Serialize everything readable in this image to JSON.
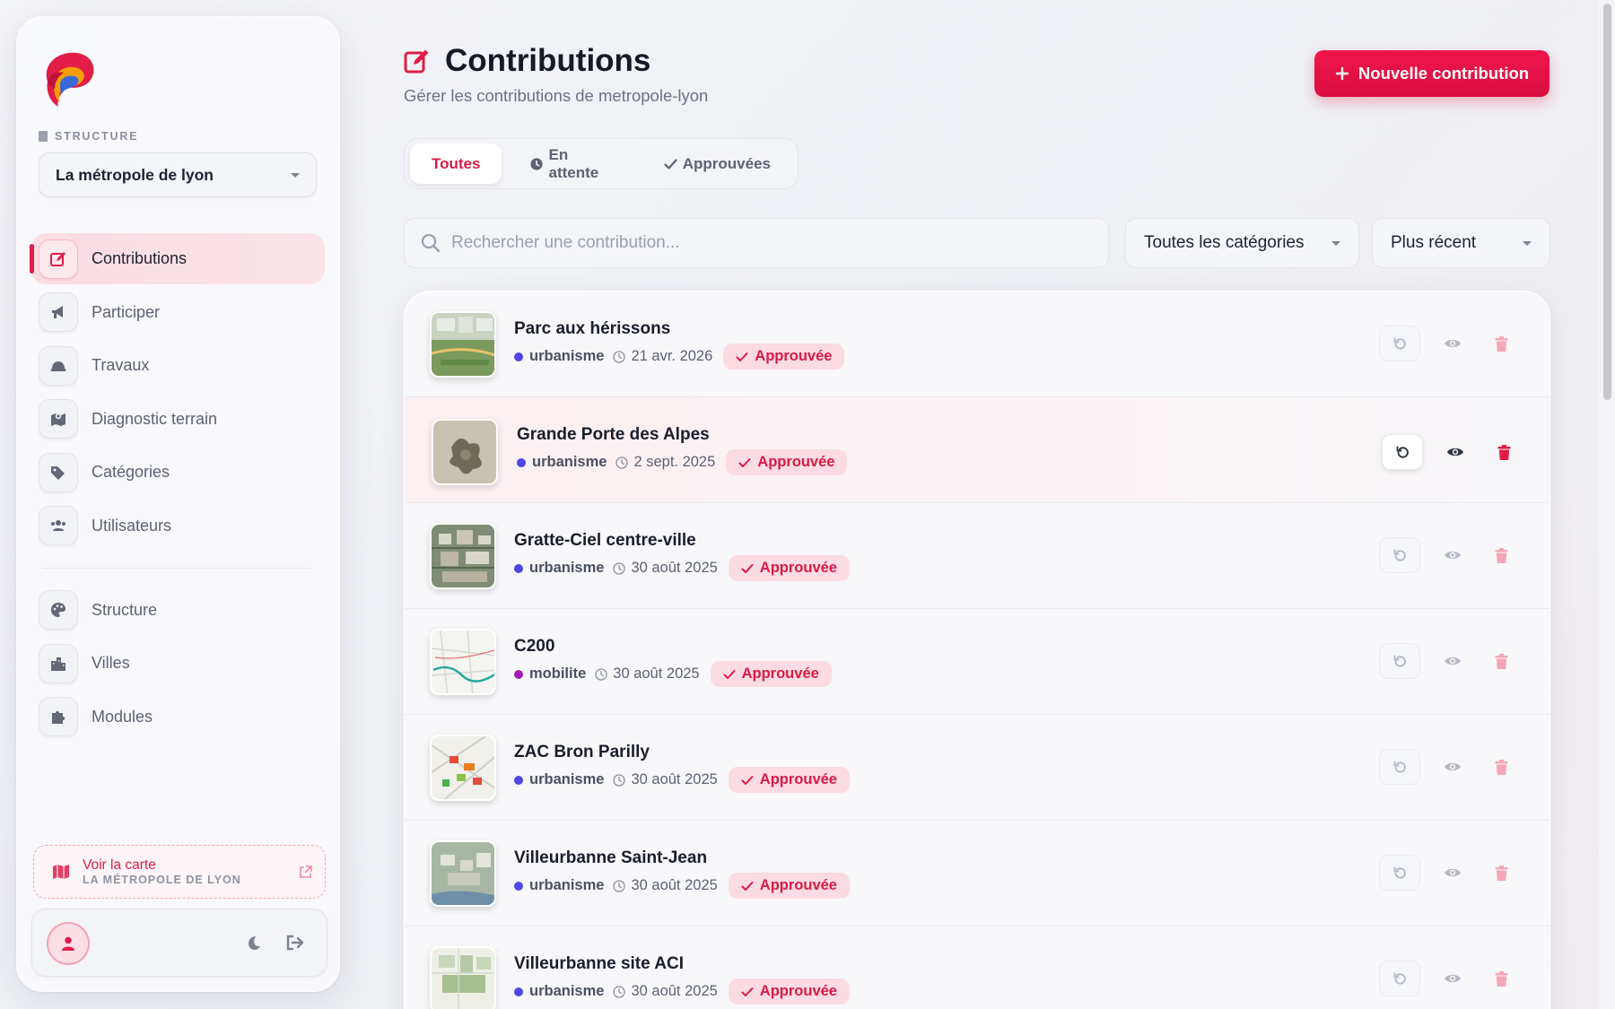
{
  "colors": {
    "accent": "#e11d48",
    "badge_bg": "#fcdbe3",
    "urbanisme": "#4f46e5",
    "mobilite": "#a21caf"
  },
  "sidebar": {
    "structure_label": "STRUCTURE",
    "structure_value": "La métropole de lyon",
    "items": [
      {
        "label": "Contributions",
        "icon": "edit-icon"
      },
      {
        "label": "Participer",
        "icon": "megaphone-icon"
      },
      {
        "label": "Travaux",
        "icon": "hardhat-icon"
      },
      {
        "label": "Diagnostic terrain",
        "icon": "map-location-icon"
      },
      {
        "label": "Catégories",
        "icon": "tags-icon"
      },
      {
        "label": "Utilisateurs",
        "icon": "users-icon"
      },
      {
        "label": "Structure",
        "icon": "palette-icon"
      },
      {
        "label": "Villes",
        "icon": "city-icon"
      },
      {
        "label": "Modules",
        "icon": "puzzle-icon"
      }
    ],
    "map_link": {
      "title": "Voir la carte",
      "subtitle": "LA MÉTROPOLE DE LYON"
    }
  },
  "header": {
    "title": "Contributions",
    "subtitle": "Gérer les contributions de metropole-lyon",
    "new_button": "Nouvelle contribution"
  },
  "tabs": [
    {
      "label": "Toutes",
      "active": true
    },
    {
      "label": "En attente",
      "icon": "clock-icon"
    },
    {
      "label": "Approuvées",
      "icon": "check-icon"
    }
  ],
  "search": {
    "placeholder": "Rechercher une contribution..."
  },
  "filters": {
    "category": "Toutes les catégories",
    "sort": "Plus récent"
  },
  "rows": [
    {
      "title": "Parc aux hérissons",
      "category": "urbanisme",
      "date": "21 avr. 2026",
      "status": "Approuvée"
    },
    {
      "title": "Grande Porte des Alpes",
      "category": "urbanisme",
      "date": "2 sept. 2025",
      "status": "Approuvée"
    },
    {
      "title": "Gratte-Ciel centre-ville",
      "category": "urbanisme",
      "date": "30 août 2025",
      "status": "Approuvée"
    },
    {
      "title": "C200",
      "category": "mobilite",
      "date": "30 août 2025",
      "status": "Approuvée"
    },
    {
      "title": "ZAC Bron Parilly",
      "category": "urbanisme",
      "date": "30 août 2025",
      "status": "Approuvée"
    },
    {
      "title": "Villeurbanne Saint-Jean",
      "category": "urbanisme",
      "date": "30 août 2025",
      "status": "Approuvée"
    },
    {
      "title": "Villeurbanne site ACI",
      "category": "urbanisme",
      "date": "30 août 2025",
      "status": "Approuvée"
    }
  ]
}
